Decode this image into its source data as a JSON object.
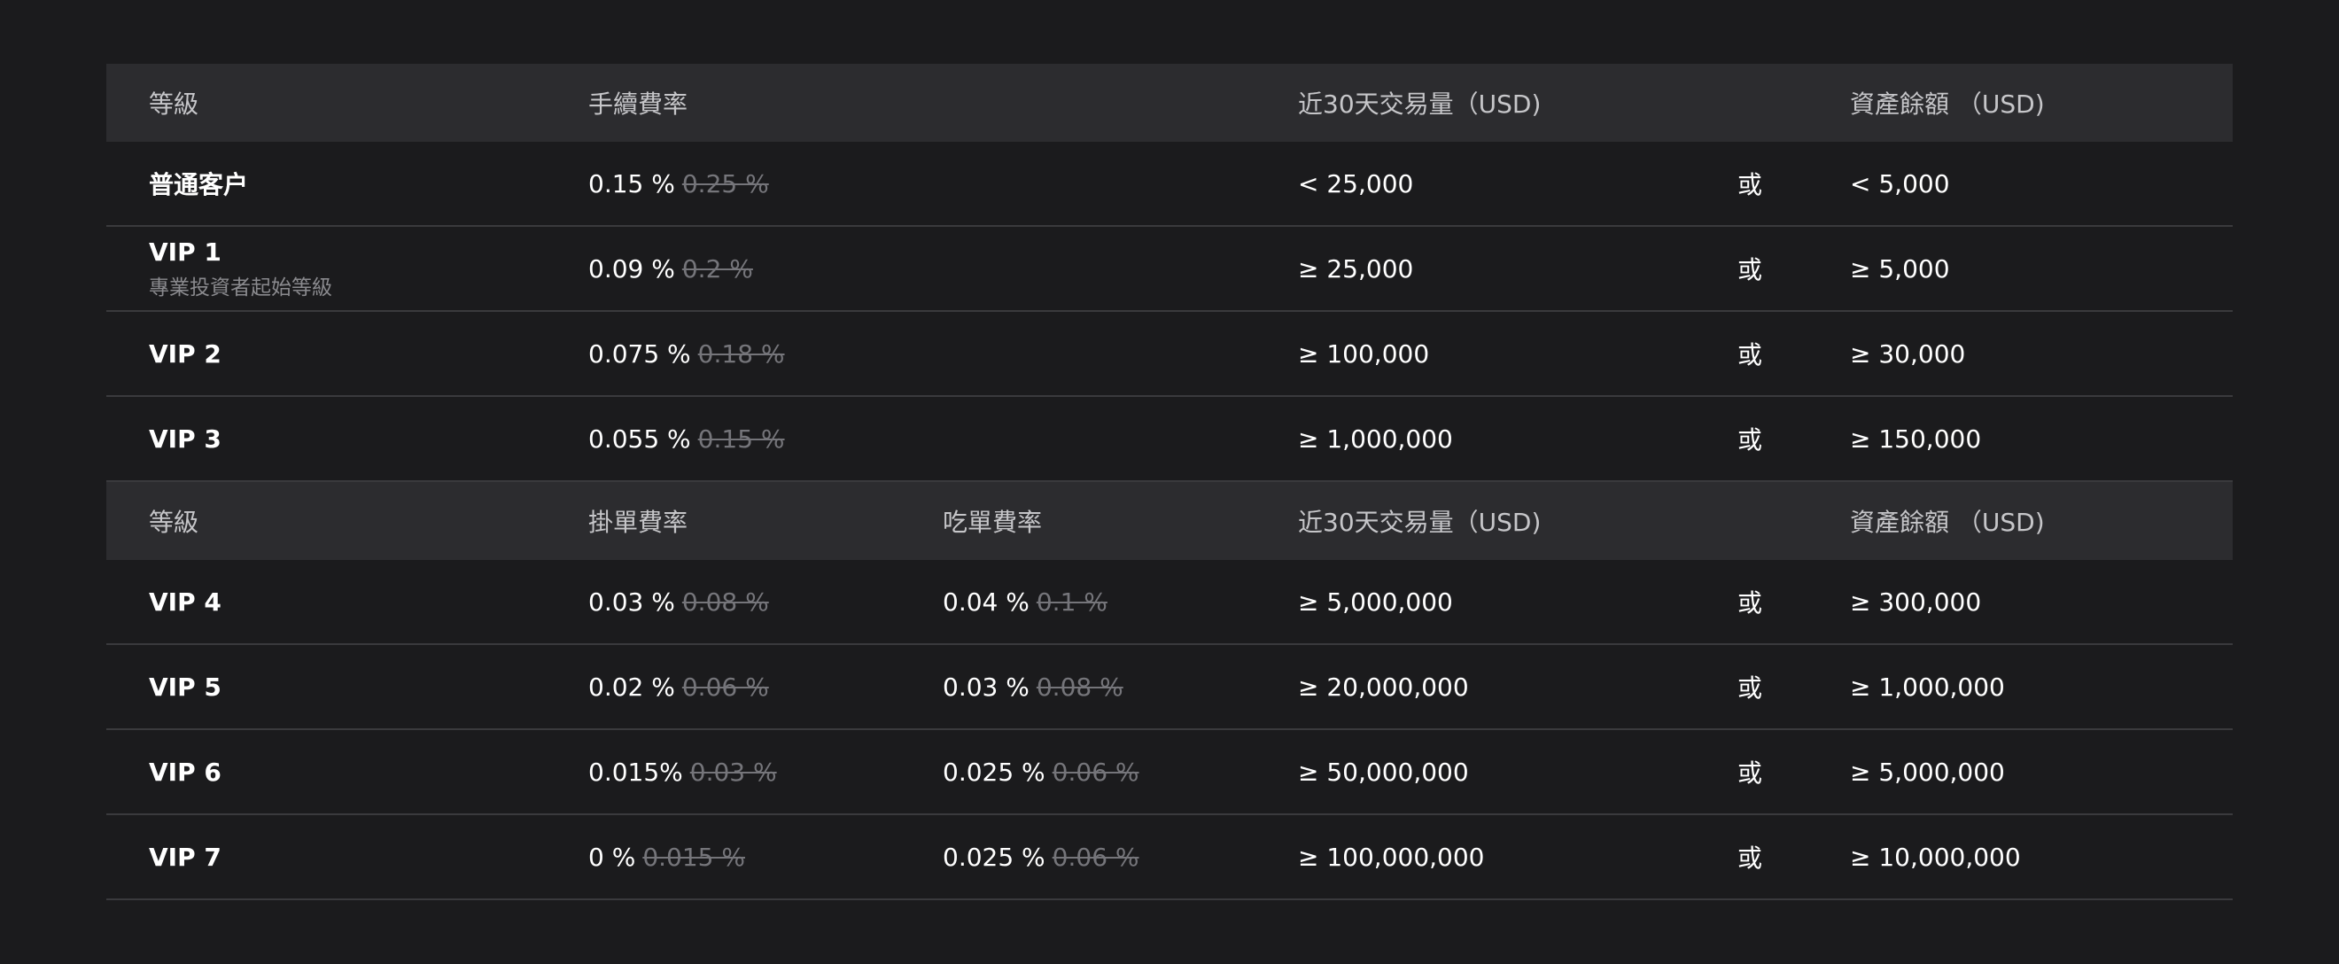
{
  "tables": {
    "basic": {
      "header": {
        "tier": "等級",
        "fee": "手續費率",
        "volume": "近30天交易量（USD)",
        "asset": "資產餘額 （USD)"
      },
      "rows": [
        {
          "tier": "普通客户",
          "sub": "",
          "fee": "0.15 %",
          "fee_old": "0.25 %",
          "volume": "<  25,000",
          "or": "或",
          "asset": "< 5,000"
        },
        {
          "tier": "VIP 1",
          "sub": "專業投資者起始等級",
          "fee": "0.09 %",
          "fee_old": "0.2 %",
          "volume": "≥ 25,000",
          "or": "或",
          "asset": "≥ 5,000"
        },
        {
          "tier": "VIP 2",
          "sub": "",
          "fee": "0.075 %",
          "fee_old": "0.18 %",
          "volume": "≥ 100,000",
          "or": "或",
          "asset": "≥ 30,000"
        },
        {
          "tier": "VIP 3",
          "sub": "",
          "fee": "0.055 %",
          "fee_old": "0.15 %",
          "volume": "≥ 1,000,000",
          "or": "或",
          "asset": "≥ 150,000"
        }
      ]
    },
    "advanced": {
      "header": {
        "tier": "等級",
        "maker": "掛單費率",
        "taker": "吃單費率",
        "volume": "近30天交易量（USD)",
        "asset": "資產餘額 （USD)"
      },
      "rows": [
        {
          "tier": "VIP 4",
          "maker": "0.03 %",
          "maker_old": "0.08 %",
          "taker": "0.04 %",
          "taker_old": "0.1 %",
          "volume": "≥ 5,000,000",
          "or": "或",
          "asset": "≥ 300,000"
        },
        {
          "tier": "VIP 5",
          "maker": "0.02 %",
          "maker_old": "0.06 %",
          "taker": "0.03 %",
          "taker_old": "0.08 %",
          "volume": "≥ 20,000,000",
          "or": "或",
          "asset": "≥ 1,000,000"
        },
        {
          "tier": "VIP 6",
          "maker": "0.015%",
          "maker_old": "0.03 %",
          "taker": "0.025 %",
          "taker_old": "0.06 %",
          "volume": "≥ 50,000,000",
          "or": "或",
          "asset": "≥ 5,000,000"
        },
        {
          "tier": "VIP 7",
          "maker": "0 %",
          "maker_old": "0.015 %",
          "taker": "0.025 %",
          "taker_old": "0.06 %",
          "volume": "≥ 100,000,000",
          "or": "或",
          "asset": "≥ 10,000,000"
        }
      ]
    }
  }
}
